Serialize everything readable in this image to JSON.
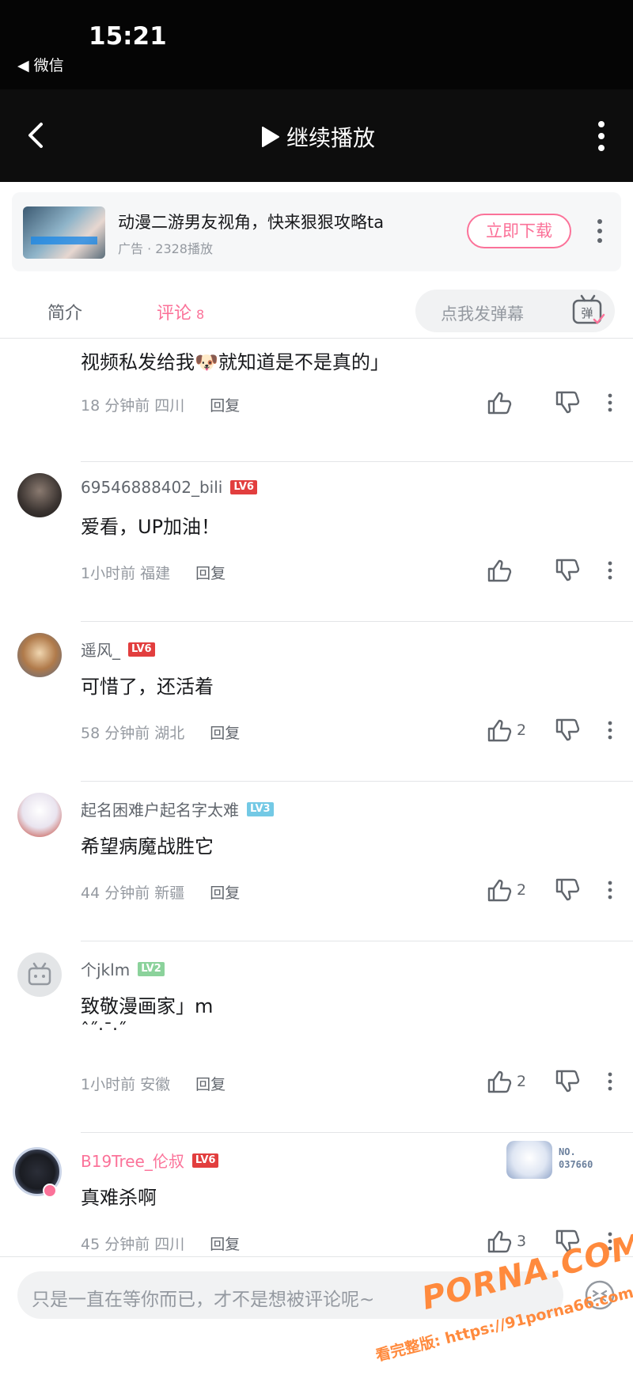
{
  "status_bar": {
    "time": "15:21",
    "back_app": "◀ 微信"
  },
  "player": {
    "play_label": "继续播放"
  },
  "ad": {
    "title": "动漫二游男友视角，快来狠狠攻略ta",
    "meta": "广告 · 2328播放",
    "download_label": "立即下载"
  },
  "tabs": {
    "intro": "简介",
    "comments": "评论",
    "comments_count": "8",
    "danmaku_placeholder": "点我发弹幕",
    "danmaku_button": "弹"
  },
  "comments": [
    {
      "text": "视频私发给我🐶就知道是不是真的」",
      "time": "18 分钟前",
      "location": "四川",
      "reply": "回复",
      "likes": ""
    },
    {
      "user": "69546888402_bili",
      "level": "LV6",
      "text": "爱看，UP加油！",
      "time": "1小时前",
      "location": "福建",
      "reply": "回复",
      "likes": ""
    },
    {
      "user": "遥风_",
      "level": "LV6",
      "text": "可惜了，还活着",
      "time": "58 分钟前",
      "location": "湖北",
      "reply": "回复",
      "likes": "2"
    },
    {
      "user": "起名困难户起名字太难",
      "level": "LV3",
      "text": "希望病魔战胜它",
      "time": "44 分钟前",
      "location": "新疆",
      "reply": "回复",
      "likes": "2"
    },
    {
      "user": "个jklm",
      "level": "LV2",
      "text": "致敬漫画家」m",
      "text2": "ˆ˝‧ˉ‧˝",
      "time": "1小时前",
      "location": "安徽",
      "reply": "回复",
      "likes": "2"
    },
    {
      "user": "B19Tree_伦叔",
      "level": "LV6",
      "text": "真难杀啊",
      "badge_no_label": "NO.",
      "badge_no": "037660",
      "time": "45 分钟前",
      "location": "四川",
      "reply": "回复",
      "likes": "3"
    }
  ],
  "comment_input": {
    "placeholder": "只是一直在等你而已，才不是想被评论呢~"
  },
  "watermark": {
    "logo": "PORNA.COM",
    "line": "看完整版: https://91porna66.com"
  },
  "colors": {
    "accent": "#fb7299",
    "muted": "#9499a0",
    "header_bg": "#0d0d0d"
  }
}
